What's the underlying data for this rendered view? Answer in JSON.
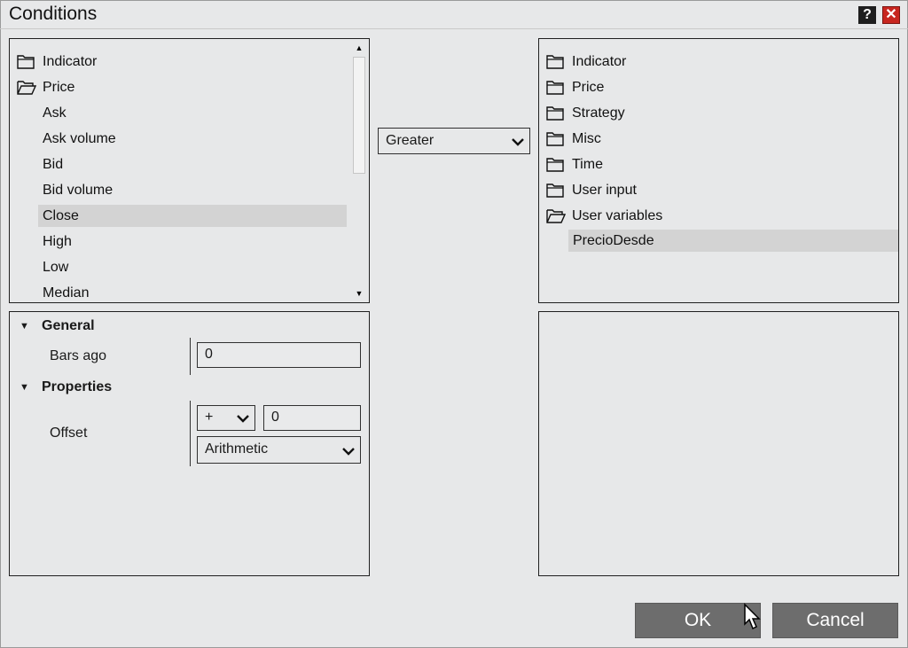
{
  "window": {
    "title": "Conditions"
  },
  "titlebar": {
    "help_label": "?",
    "close_label": "✕"
  },
  "left_tree": {
    "items": [
      {
        "label": "Indicator",
        "icon": "folder-icon"
      },
      {
        "label": "Price",
        "icon": "folder-open-icon"
      },
      {
        "label": "Ask"
      },
      {
        "label": "Ask volume"
      },
      {
        "label": "Bid"
      },
      {
        "label": "Bid volume"
      },
      {
        "label": "Close",
        "selected": true
      },
      {
        "label": "High"
      },
      {
        "label": "Low"
      },
      {
        "label": "Median"
      }
    ]
  },
  "operator": {
    "value": "Greater"
  },
  "right_tree": {
    "items": [
      {
        "label": "Indicator",
        "icon": "folder-icon"
      },
      {
        "label": "Price",
        "icon": "folder-icon"
      },
      {
        "label": "Strategy",
        "icon": "folder-icon"
      },
      {
        "label": "Misc",
        "icon": "folder-icon"
      },
      {
        "label": "Time",
        "icon": "folder-icon"
      },
      {
        "label": "User input",
        "icon": "folder-icon"
      },
      {
        "label": "User variables",
        "icon": "folder-open-icon"
      },
      {
        "label": "PrecioDesde",
        "selected": true
      }
    ]
  },
  "properties": {
    "general_label": "General",
    "bars_ago_label": "Bars ago",
    "bars_ago_value": "0",
    "properties_label": "Properties",
    "offset_label": "Offset",
    "offset_sign": "+",
    "offset_value": "0",
    "offset_mode": "Arithmetic"
  },
  "buttons": {
    "ok": "OK",
    "cancel": "Cancel"
  }
}
